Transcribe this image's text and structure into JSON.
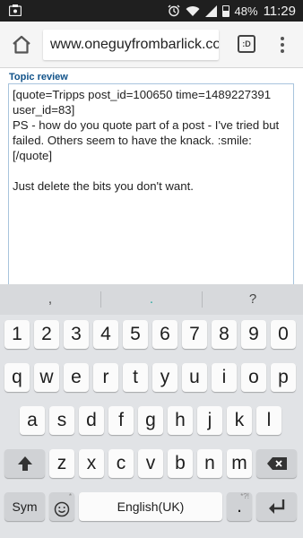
{
  "status_bar": {
    "battery_percent": "48%",
    "time": "11:29",
    "icons": [
      "notification-icon",
      "alarm-icon",
      "wifi-icon",
      "signal-icon",
      "battery-icon"
    ]
  },
  "browser": {
    "url": "www.oneguyfrombarlick.co.",
    "tabs_label": ":D"
  },
  "page": {
    "section_title": "Topic review",
    "review_text": "[quote=Tripps post_id=100650 time=1489227391 user_id=83]\nPS - how do you quote part of a post - I've tried but failed. Others seem to have the knack. :smile:\n[/quote]\n\nJust delete the bits you don't want."
  },
  "keyboard": {
    "suggestions": [
      ",",
      ".",
      "?"
    ],
    "numbers": [
      "1",
      "2",
      "3",
      "4",
      "5",
      "6",
      "7",
      "8",
      "9",
      "0"
    ],
    "row1": [
      "q",
      "w",
      "e",
      "r",
      "t",
      "y",
      "u",
      "i",
      "o",
      "p"
    ],
    "row2": [
      "a",
      "s",
      "d",
      "f",
      "g",
      "h",
      "j",
      "k",
      "l"
    ],
    "row3": [
      "z",
      "x",
      "c",
      "v",
      "b",
      "n",
      "m"
    ],
    "sym_label": "Sym",
    "space_label": "English(UK)",
    "period_label": ".",
    "period_hint": "*?!",
    "comma_hint": ",",
    "emoji_hint": "*",
    "accent_color": "#2aa8a0"
  }
}
